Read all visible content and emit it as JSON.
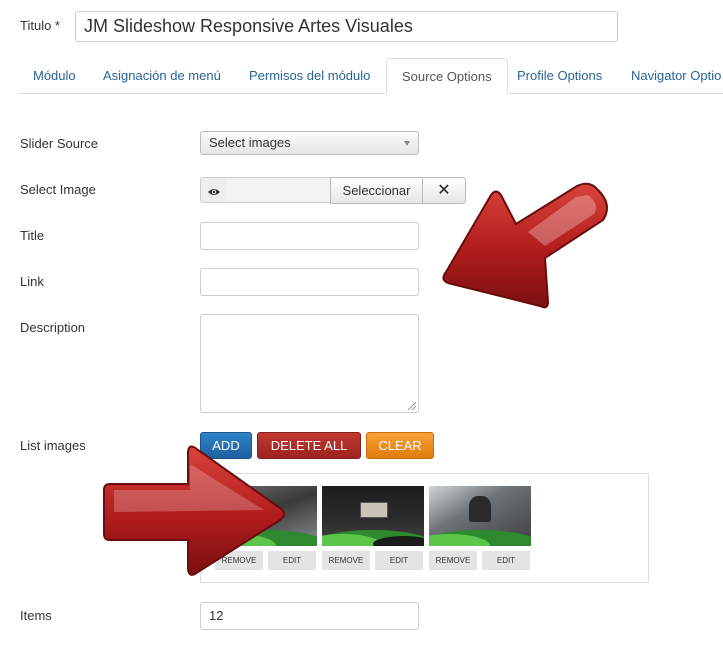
{
  "header": {
    "title_label": "Titulo *",
    "title_value": "JM Slideshow Responsive Artes Visuales"
  },
  "tabs": [
    {
      "label": "Módulo",
      "active": false
    },
    {
      "label": "Asignación de menú",
      "active": false
    },
    {
      "label": "Permisos del módulo",
      "active": false
    },
    {
      "label": "Source Options",
      "active": true
    },
    {
      "label": "Profile Options",
      "active": false
    },
    {
      "label": "Navigator Optio",
      "active": false
    }
  ],
  "form": {
    "slider_source_label": "Slider Source",
    "slider_source_value": "Select images",
    "select_image_label": "Select Image",
    "select_button": "Seleccionar",
    "clear_button": "✕",
    "title_label": "Title",
    "link_label": "Link",
    "description_label": "Description",
    "list_images_label": "List images",
    "items_label": "Items",
    "items_value": "12"
  },
  "actions": {
    "add": "ADD",
    "delete_all": "DELETE ALL",
    "clear": "CLEAR"
  },
  "images": [
    {
      "remove": "REMOVE",
      "edit": "EDIT"
    },
    {
      "remove": "REMOVE",
      "edit": "EDIT"
    },
    {
      "remove": "REMOVE",
      "edit": "EDIT"
    }
  ],
  "colors": {
    "tab_link": "#2a6496",
    "add_button": "#1f5fa0",
    "delete_button": "#9d2421",
    "clear_button": "#e07c0c",
    "arrow": "#b01c1c"
  },
  "icons": {
    "preview": "eye-icon",
    "clear": "close-icon",
    "dropdown": "caret-down-icon",
    "annotation": "arrow-icon"
  }
}
